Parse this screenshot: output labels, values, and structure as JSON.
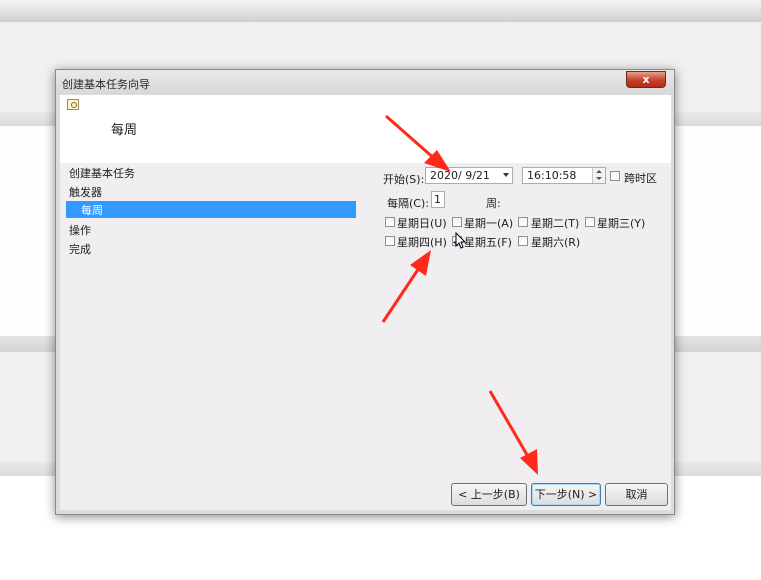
{
  "dialog": {
    "title": "创建基本任务向导",
    "close_label": "x",
    "header_title": "每周"
  },
  "nav": {
    "items": [
      "创建基本任务",
      "触发器",
      "每周",
      "操作",
      "完成"
    ]
  },
  "form": {
    "start_label": "开始(S):",
    "start_date": "2020/  9/21",
    "start_time": "16:10:58",
    "sync_label": "跨时区",
    "sync_checked": false,
    "recur_label": "每隔(C):",
    "recur_value": "1",
    "week_label": "周:",
    "days": [
      {
        "label": "星期日(U)",
        "checked": false
      },
      {
        "label": "星期一(A)",
        "checked": false
      },
      {
        "label": "星期二(T)",
        "checked": false
      },
      {
        "label": "星期三(Y)",
        "checked": false
      },
      {
        "label": "星期四(H)",
        "checked": false
      },
      {
        "label": "星期五(F)",
        "checked": true
      },
      {
        "label": "星期六(R)",
        "checked": false
      }
    ]
  },
  "buttons": {
    "back": "< 上一步(B)",
    "next": "下一步(N) >",
    "cancel": "取消"
  },
  "colors": {
    "selection": "#3399ff",
    "annotation_arrow": "#ff2a1a"
  }
}
